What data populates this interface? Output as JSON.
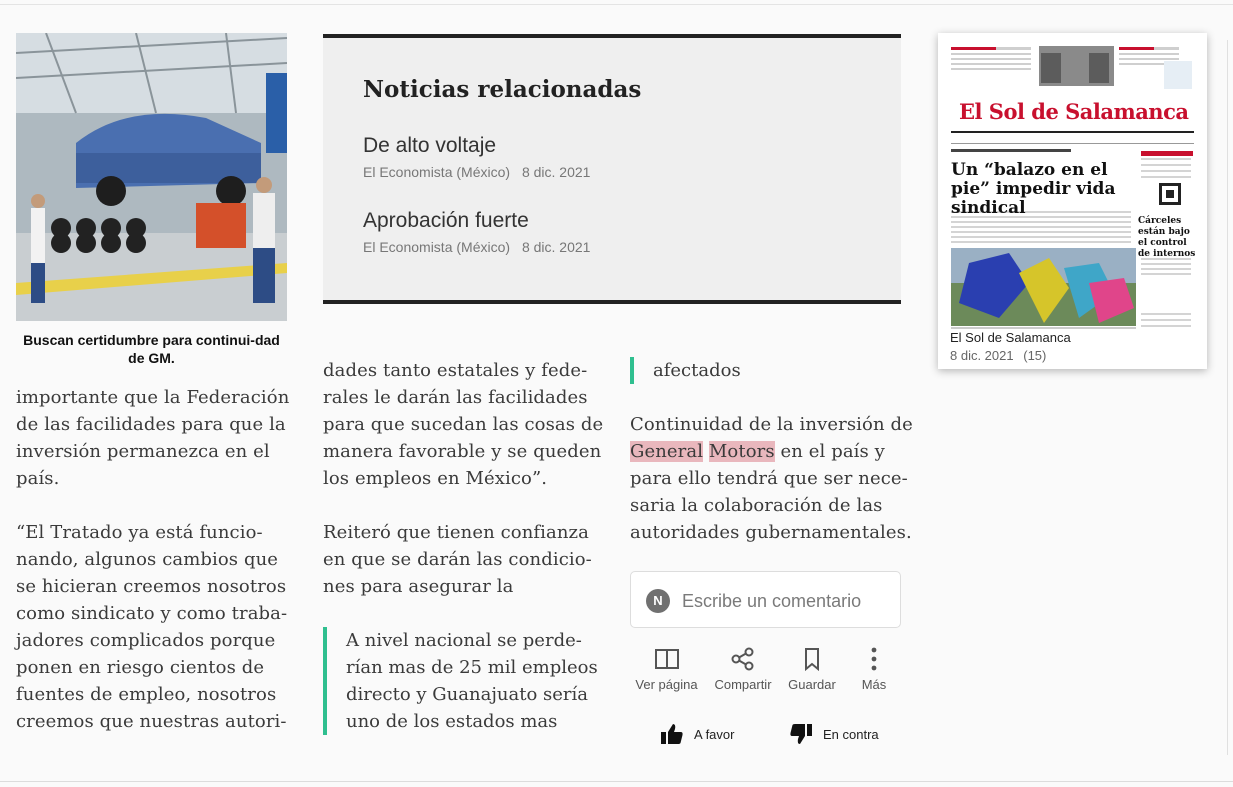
{
  "article": {
    "photo": {
      "alt": "",
      "icon": "factory-photo"
    },
    "caption": "Buscan certidumbre para continui-dad de GM.",
    "col1": [
      "importante que la Federación de las facilidades para que la inversión permanezca en el país.",
      "“El Tratado ya está funcio-nando, algunos cambios que se hicieran creemos nosotros como sindicato y como traba-jadores complicados porque ponen en riesgo cientos de fuentes de empleo, nosotros creemos que nuestras autori-"
    ],
    "col2": [
      "dades tanto estatales y fede-rales le darán las facilidades para que sucedan las cosas de manera favorable y se queden los empleos en México”.",
      "Reiteró que tienen confianza en que se darán las condicio-nes para asegurar la"
    ],
    "col2_quote": "A nivel nacional se perde-rían mas de 25 mil empleos directo y Guanajuato sería uno de los estados mas",
    "col3_quote": "afectados",
    "col3": {
      "before": "Continuidad de la inversión de ",
      "hl1": "General",
      "hl2": "Motors",
      "after": " en el país y para ello tendrá que ser nece-saria la colaboración de las autoridades gubernamentales."
    }
  },
  "related": {
    "heading": "Noticias relacionadas",
    "items": [
      {
        "title": "De alto voltaje",
        "source": "El Economista (México)",
        "date": "8 dic. 2021"
      },
      {
        "title": "Aprobación fuerte",
        "source": "El Economista (México)",
        "date": "8 dic. 2021"
      }
    ]
  },
  "comment": {
    "avatar_letter": "N",
    "placeholder": "Escribe un comentario"
  },
  "actions": [
    {
      "label": "Ver página",
      "icon": "book-open-icon"
    },
    {
      "label": "Compartir",
      "icon": "share-icon"
    },
    {
      "label": "Guardar",
      "icon": "bookmark-icon"
    },
    {
      "label": "Más",
      "icon": "more-vertical-icon"
    }
  ],
  "votes": {
    "favor": "A favor",
    "contra": "En contra"
  },
  "newspaper": {
    "name": "El Sol de Salamanca",
    "date": "8 dic. 2021",
    "count": "(15)",
    "masthead": "El Sol de Salamanca",
    "headline": "Un “balazo en el pie” impedir vida sindical",
    "side_headline": "Cárceles están bajo el control de internos"
  },
  "colors": {
    "accent": "#2fbf8f",
    "highlight": "#e9b7bd",
    "masthead": "#c8102e"
  }
}
